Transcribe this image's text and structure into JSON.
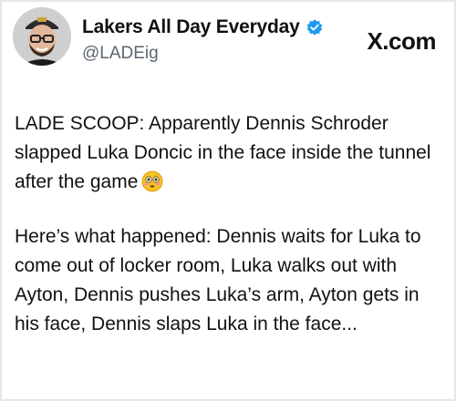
{
  "header": {
    "display_name": "Lakers All Day Everyday",
    "handle": "@LADEig",
    "brand": "X.com",
    "avatar_icon": "person-avatar-icon",
    "verified_icon": "verified-badge-icon"
  },
  "tweet": {
    "paragraph_1": "LADE SCOOP: Apparently Dennis Schroder slapped Luka Doncic in the face inside the tunnel after the game",
    "emoji_icon": "flushed-face-emoji-icon",
    "paragraph_2": "Here’s what happened: Dennis waits for Luka to come out of locker room, Luka walks out with Ayton, Dennis pushes Luka’s arm, Ayton gets in his face, Dennis slaps Luka in the face..."
  },
  "colors": {
    "verified": "#1d9bf0",
    "handle": "#5b6670",
    "text": "#111111",
    "emoji": "#f7c325"
  }
}
